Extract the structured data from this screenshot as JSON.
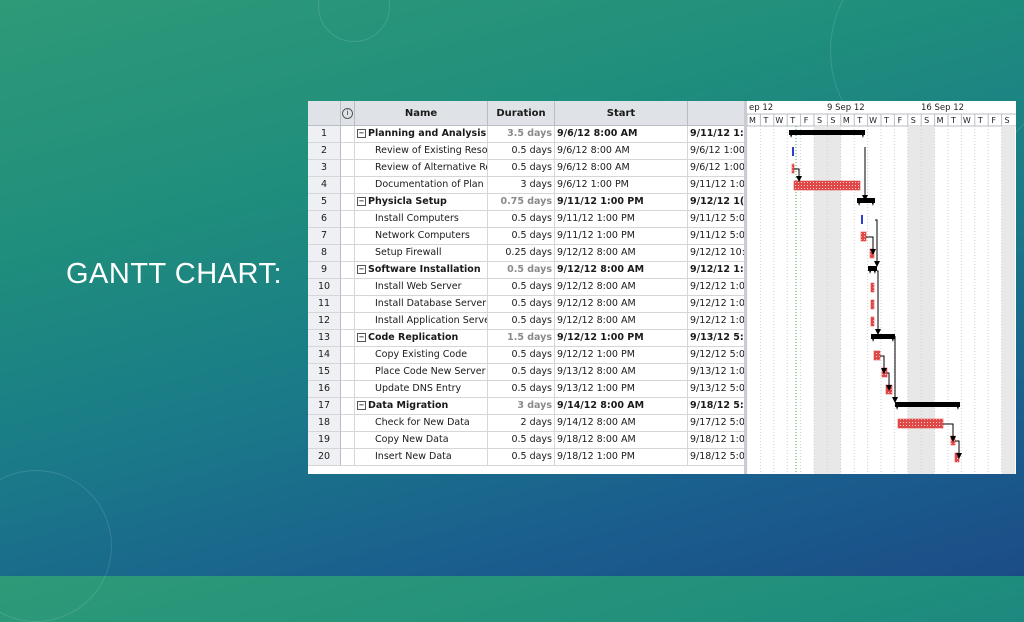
{
  "slide": {
    "title": "GANTT CHART:"
  },
  "table": {
    "headers": {
      "info": "i",
      "name": "Name",
      "duration": "Duration",
      "start": "Start",
      "finish": ""
    },
    "rows": [
      {
        "id": "1",
        "name": "Planning and Analysis",
        "duration": "3.5 days",
        "start": "9/6/12 8:00 AM",
        "finish": "9/11/12 1:",
        "summary": true
      },
      {
        "id": "2",
        "name": "Review of Existing Resourc",
        "duration": "0.5 days",
        "start": "9/6/12 8:00 AM",
        "finish": "9/6/12 1:00",
        "summary": false
      },
      {
        "id": "3",
        "name": "Review of Alternative Reso",
        "duration": "0.5 days",
        "start": "9/6/12 8:00 AM",
        "finish": "9/6/12 1:00",
        "summary": false
      },
      {
        "id": "4",
        "name": "Documentation of Plan",
        "duration": "3 days",
        "start": "9/6/12 1:00 PM",
        "finish": "9/11/12 1:0",
        "summary": false
      },
      {
        "id": "5",
        "name": "Physicla Setup",
        "duration": "0.75 days",
        "start": "9/11/12 1:00 PM",
        "finish": "9/12/12 1(",
        "summary": true
      },
      {
        "id": "6",
        "name": "Install Computers",
        "duration": "0.5 days",
        "start": "9/11/12 1:00 PM",
        "finish": "9/11/12 5:0",
        "summary": false
      },
      {
        "id": "7",
        "name": "Network Computers",
        "duration": "0.5 days",
        "start": "9/11/12 1:00 PM",
        "finish": "9/11/12 5:0",
        "summary": false
      },
      {
        "id": "8",
        "name": "Setup Firewall",
        "duration": "0.25 days",
        "start": "9/12/12 8:00 AM",
        "finish": "9/12/12 10:",
        "summary": false
      },
      {
        "id": "9",
        "name": "Software Installation",
        "duration": "0.5 days",
        "start": "9/12/12 8:00 AM",
        "finish": "9/12/12 1:",
        "summary": true
      },
      {
        "id": "10",
        "name": "Install Web Server",
        "duration": "0.5 days",
        "start": "9/12/12 8:00 AM",
        "finish": "9/12/12 1:0",
        "summary": false
      },
      {
        "id": "11",
        "name": "Install Database Server",
        "duration": "0.5 days",
        "start": "9/12/12 8:00 AM",
        "finish": "9/12/12 1:0",
        "summary": false
      },
      {
        "id": "12",
        "name": "Install Application Server",
        "duration": "0.5 days",
        "start": "9/12/12 8:00 AM",
        "finish": "9/12/12 1:0",
        "summary": false
      },
      {
        "id": "13",
        "name": "Code Replication",
        "duration": "1.5 days",
        "start": "9/12/12 1:00 PM",
        "finish": "9/13/12 5:",
        "summary": true
      },
      {
        "id": "14",
        "name": "Copy Existing Code",
        "duration": "0.5 days",
        "start": "9/12/12 1:00 PM",
        "finish": "9/12/12 5:0",
        "summary": false
      },
      {
        "id": "15",
        "name": "Place Code New Server",
        "duration": "0.5 days",
        "start": "9/13/12 8:00 AM",
        "finish": "9/13/12 1:0",
        "summary": false
      },
      {
        "id": "16",
        "name": "Update DNS Entry",
        "duration": "0.5 days",
        "start": "9/13/12 1:00 PM",
        "finish": "9/13/12 5:0",
        "summary": false
      },
      {
        "id": "17",
        "name": "Data Migration",
        "duration": "3 days",
        "start": "9/14/12 8:00 AM",
        "finish": "9/18/12 5:",
        "summary": true
      },
      {
        "id": "18",
        "name": "Check for New Data",
        "duration": "2 days",
        "start": "9/14/12 8:00 AM",
        "finish": "9/17/12 5:0",
        "summary": false
      },
      {
        "id": "19",
        "name": "Copy New Data",
        "duration": "0.5 days",
        "start": "9/18/12 8:00 AM",
        "finish": "9/18/12 1:0",
        "summary": false
      },
      {
        "id": "20",
        "name": "Insert New Data",
        "duration": "0.5 days",
        "start": "9/18/12 1:00 PM",
        "finish": "9/18/12 5:0",
        "summary": false
      }
    ]
  },
  "timeline": {
    "weeks": [
      "ep 12",
      "9 Sep 12",
      "16 Sep 12"
    ],
    "days": [
      "M",
      "T",
      "W",
      "T",
      "F",
      "S",
      "S",
      "M",
      "T",
      "W",
      "T",
      "F",
      "S",
      "S",
      "M",
      "T",
      "W",
      "T",
      "F",
      "S"
    ]
  },
  "colors": {
    "task_bar": "#e04848",
    "summary_bar": "#000000",
    "milestone": "#2a3fd0",
    "weekend_shade": "#e8e8e8"
  }
}
